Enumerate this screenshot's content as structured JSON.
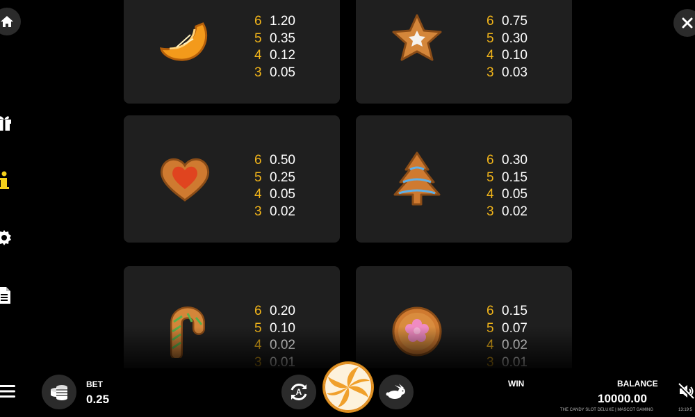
{
  "nav": {
    "home_icon": "home-icon",
    "close_icon": "close-icon",
    "side_icons": [
      "gift-icon",
      "info-icon",
      "gear-icon",
      "document-icon"
    ]
  },
  "paytable": [
    {
      "symbol": "orange-slice",
      "pays": [
        [
          "6",
          "1.20"
        ],
        [
          "5",
          "0.35"
        ],
        [
          "4",
          "0.12"
        ],
        [
          "3",
          "0.05"
        ]
      ]
    },
    {
      "symbol": "star-cookie",
      "pays": [
        [
          "6",
          "0.75"
        ],
        [
          "5",
          "0.30"
        ],
        [
          "4",
          "0.10"
        ],
        [
          "3",
          "0.03"
        ]
      ]
    },
    {
      "symbol": "heart-jam-cookie",
      "pays": [
        [
          "6",
          "0.50"
        ],
        [
          "5",
          "0.25"
        ],
        [
          "4",
          "0.05"
        ],
        [
          "3",
          "0.02"
        ]
      ]
    },
    {
      "symbol": "tree-gingerbread",
      "pays": [
        [
          "6",
          "0.30"
        ],
        [
          "5",
          "0.15"
        ],
        [
          "4",
          "0.05"
        ],
        [
          "3",
          "0.02"
        ]
      ]
    },
    {
      "symbol": "candy-cane-cookie",
      "pays": [
        [
          "6",
          "0.20"
        ],
        [
          "5",
          "0.10"
        ],
        [
          "4",
          "0.02"
        ],
        [
          "3",
          "0.01"
        ]
      ]
    },
    {
      "symbol": "flower-round-cookie",
      "pays": [
        [
          "6",
          "0.15"
        ],
        [
          "5",
          "0.07"
        ],
        [
          "4",
          "0.02"
        ],
        [
          "3",
          "0.01"
        ]
      ]
    }
  ],
  "bottom": {
    "bet_label": "BET",
    "bet_value": "0.25",
    "win_label": "WIN",
    "balance_label": "BALANCE",
    "balance_value": "10000.00",
    "credits": "THE CANDY SLOT DELUXE | MASCOT GAMING",
    "clock": "13:19:5",
    "auto_letter": "A"
  },
  "colors": {
    "multiplier": "#f2b51a",
    "card_bg": "#1f1f1f",
    "button_bg": "#2b2b2b",
    "info_icon": "#f5d21b"
  }
}
